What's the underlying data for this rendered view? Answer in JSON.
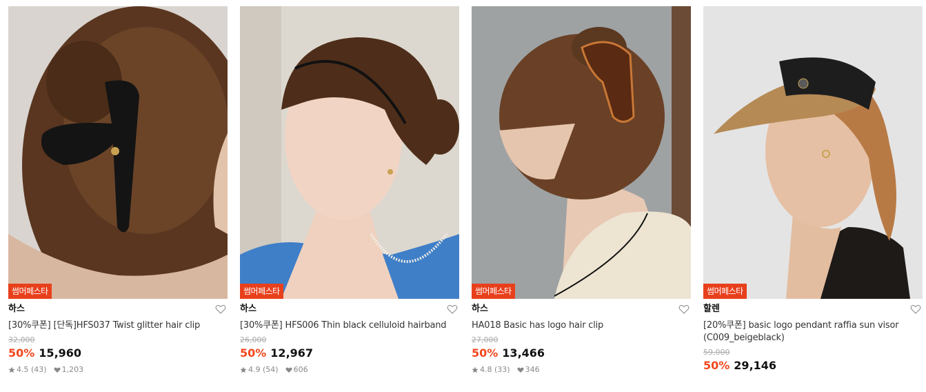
{
  "products": [
    {
      "badge": "썸머페스타",
      "brand": "하스",
      "title": "[30%쿠폰] [단독]HFS037 Twist glitter hair clip",
      "original_price": "32,000",
      "discount": "50%",
      "price": "15,960",
      "rating": "4.5",
      "reviews": "(43)",
      "likes": "1,203",
      "image": "woman-back-of-head-black-claw-clip"
    },
    {
      "badge": "썸머페스타",
      "brand": "하스",
      "title": "[30%쿠폰] HFS006 Thin black celluloid hairband",
      "original_price": "26,000",
      "discount": "50%",
      "price": "12,967",
      "rating": "4.9",
      "reviews": "(54)",
      "likes": "606",
      "image": "woman-profile-thin-black-hairband"
    },
    {
      "badge": "썸머페스타",
      "brand": "하스",
      "title": "HA018 Basic has logo hair clip",
      "original_price": "27,000",
      "discount": "50%",
      "price": "13,466",
      "rating": "4.8",
      "reviews": "(33)",
      "likes": "346",
      "image": "woman-back-tortoise-hair-clip"
    },
    {
      "badge": "썸머페스타",
      "brand": "할렌",
      "title": "[20%쿠폰] basic logo pendant raffia sun visor (C009_beigeblack)",
      "original_price": "59,000",
      "discount": "50%",
      "price": "29,146",
      "rating": "",
      "reviews": "",
      "likes": "",
      "image": "woman-profile-raffia-sun-visor"
    }
  ],
  "colors": {
    "badge_bg": "#e8401c",
    "discount": "#f1471d"
  }
}
